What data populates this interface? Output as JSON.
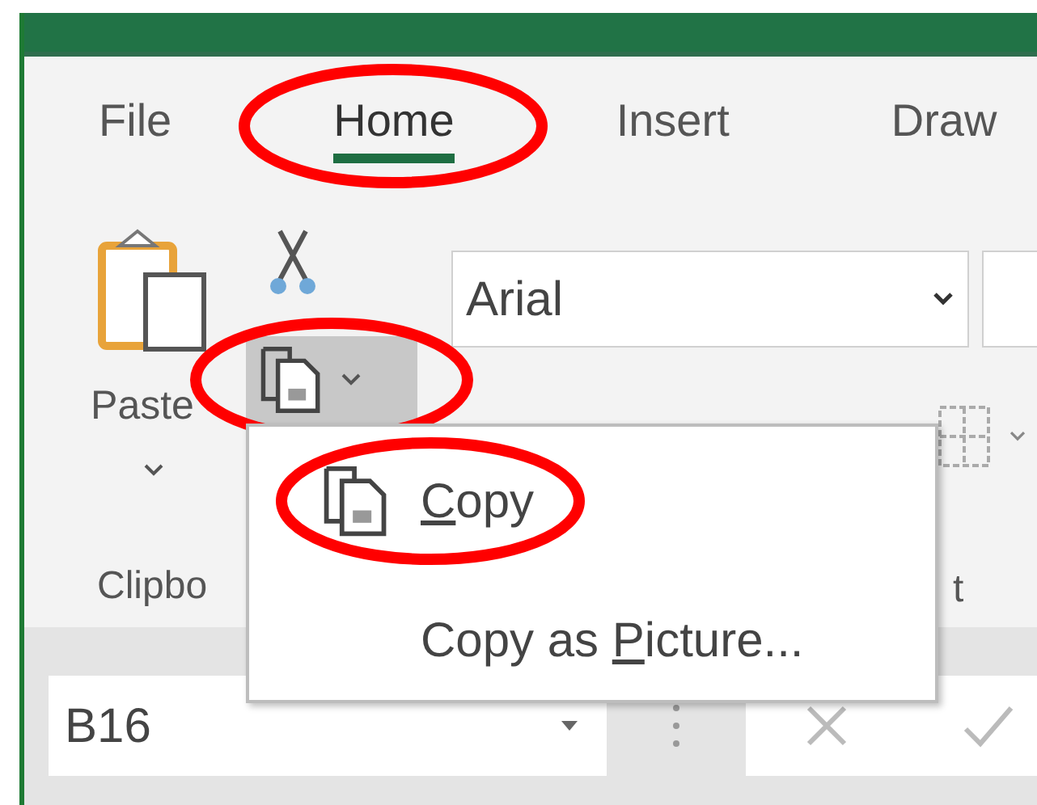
{
  "tabs": [
    {
      "label": "File",
      "selected": false,
      "circled": false
    },
    {
      "label": "Home",
      "selected": true,
      "circled": true
    },
    {
      "label": "Insert",
      "selected": false,
      "circled": false
    },
    {
      "label": "Draw",
      "selected": false,
      "circled": false
    }
  ],
  "clipboard_group": {
    "paste_label": "Paste",
    "copy_button": {
      "pressed": true,
      "circled": true
    },
    "group_label": "Clipbo"
  },
  "font_group": {
    "font_name": "Arial",
    "group_label": "t"
  },
  "copy_menu": {
    "items": [
      {
        "kind": "icon",
        "accelerator": "C",
        "after": "opy",
        "circled": true
      },
      {
        "kind": "plain",
        "before": "Copy as ",
        "accelerator": "P",
        "after": "icture...",
        "circled": false
      }
    ]
  },
  "name_box": {
    "value": "B16"
  }
}
